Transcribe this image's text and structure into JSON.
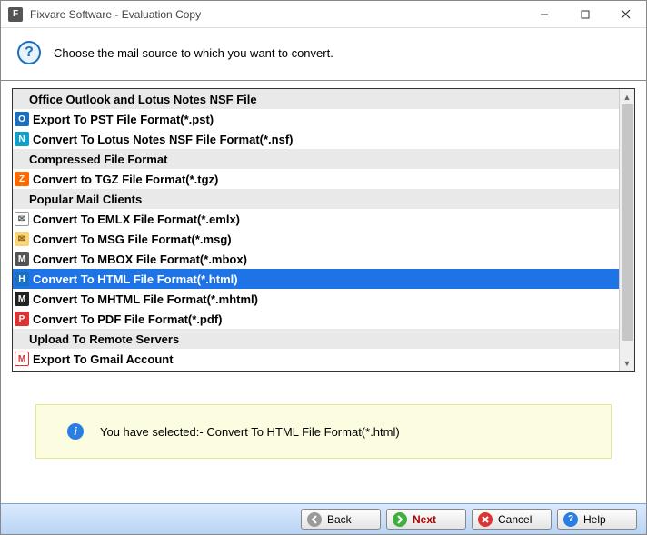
{
  "window": {
    "title": "Fixvare Software - Evaluation Copy"
  },
  "header": {
    "instruction": "Choose the mail source to which you want to convert."
  },
  "list": {
    "groups": [
      {
        "header": "Office Outlook and Lotus Notes NSF File",
        "items": [
          {
            "icon": "outlook",
            "label": "Export To PST File Format(*.pst)"
          },
          {
            "icon": "nsf",
            "label": "Convert To Lotus Notes NSF File Format(*.nsf)"
          }
        ]
      },
      {
        "header": "Compressed File Format",
        "items": [
          {
            "icon": "tgz",
            "label": "Convert to TGZ File Format(*.tgz)"
          }
        ]
      },
      {
        "header": "Popular Mail Clients",
        "items": [
          {
            "icon": "emlx",
            "label": "Convert To EMLX File Format(*.emlx)"
          },
          {
            "icon": "msg",
            "label": "Convert To MSG File Format(*.msg)"
          },
          {
            "icon": "mbox",
            "label": "Convert To MBOX File Format(*.mbox)"
          },
          {
            "icon": "html",
            "label": "Convert To HTML File Format(*.html)",
            "selected": true
          },
          {
            "icon": "mhtml",
            "label": "Convert To MHTML File Format(*.mhtml)"
          },
          {
            "icon": "pdf",
            "label": "Convert To PDF File Format(*.pdf)"
          }
        ]
      },
      {
        "header": "Upload To Remote Servers",
        "items": [
          {
            "icon": "gmail",
            "label": "Export To Gmail Account"
          }
        ]
      }
    ]
  },
  "info": {
    "message": "You have selected:- Convert To HTML File Format(*.html)"
  },
  "buttons": {
    "back": "Back",
    "next": "Next",
    "cancel": "Cancel",
    "help": "Help"
  },
  "icon_colors": {
    "outlook": {
      "bg": "#1a6fbf",
      "fg": "#fff",
      "txt": "O"
    },
    "nsf": {
      "bg": "#12a0c9",
      "fg": "#fff",
      "txt": "N"
    },
    "tgz": {
      "bg": "#ff6a00",
      "fg": "#fff",
      "txt": "Z"
    },
    "emlx": {
      "bg": "#ffffff",
      "fg": "#555",
      "txt": "✉",
      "border": "#999"
    },
    "msg": {
      "bg": "#f6d57a",
      "fg": "#8a5a00",
      "txt": "✉"
    },
    "mbox": {
      "bg": "#555",
      "fg": "#fff",
      "txt": "M"
    },
    "html": {
      "bg": "#1a6fbf",
      "fg": "#fff",
      "txt": "H"
    },
    "mhtml": {
      "bg": "#222",
      "fg": "#fff",
      "txt": "M"
    },
    "pdf": {
      "bg": "#d33",
      "fg": "#fff",
      "txt": "P"
    },
    "gmail": {
      "bg": "#fff",
      "fg": "#d33",
      "txt": "M",
      "border": "#d33"
    }
  }
}
